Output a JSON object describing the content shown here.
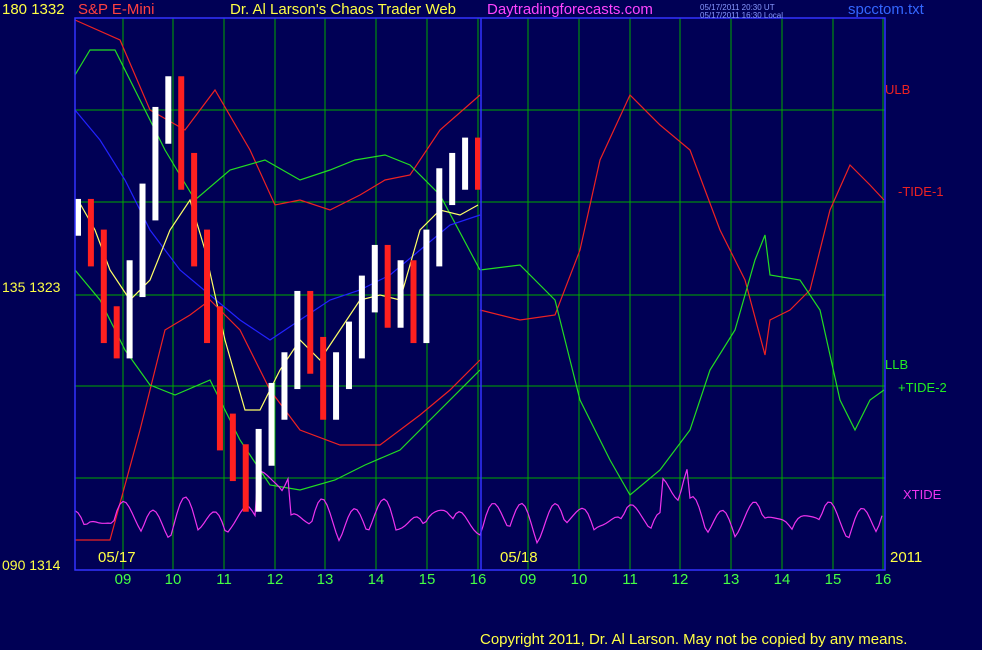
{
  "header": {
    "y_top_label": "180  1332",
    "instrument": "S&P E-Mini",
    "title": "Dr. Al Larson's Chaos Trader Web",
    "website": "Daytradingforecasts.com",
    "timestamp_ut": "05/17/2011 20:30 UT",
    "timestamp_local": "05/17/2011 16:30 Local",
    "filename": "spcctom.txt"
  },
  "colors": {
    "background": "#000055",
    "grid": "#00aa00",
    "price_up": "#ffffff",
    "price_down": "#ff2020",
    "ulb": "#ee2222",
    "llb": "#22dd22",
    "tide": "#2222ff",
    "xtide": "#ee33ee",
    "avg": "#ffff66",
    "copyright": "#ffff44"
  },
  "chart_data": {
    "type": "line",
    "title": "Dr. Al Larson's Chaos Trader Web",
    "instrument": "S&P E-Mini",
    "y_axis": {
      "ticks": [
        {
          "label": "180  1332",
          "price": 1332
        },
        {
          "label": "135  1323",
          "price": 1323
        },
        {
          "label": "090  1314",
          "price": 1314
        }
      ],
      "ylim": [
        1314,
        1332
      ]
    },
    "x_axis": {
      "hour_labels": [
        "09",
        "10",
        "11",
        "12",
        "13",
        "14",
        "15",
        "16",
        "09",
        "10",
        "11",
        "12",
        "13",
        "14",
        "15",
        "16"
      ],
      "date_labels": [
        "05/17",
        "05/18"
      ],
      "year_label": "2011"
    },
    "right_labels": [
      "ULB",
      "-TIDE-1",
      "LLB",
      "+TIDE-2",
      "XTIDE"
    ],
    "series": [
      {
        "name": "ULB",
        "kind": "red"
      },
      {
        "name": "-TIDE-1",
        "kind": "red"
      },
      {
        "name": "LLB",
        "kind": "green"
      },
      {
        "name": "+TIDE-2",
        "kind": "green"
      },
      {
        "name": "XTIDE",
        "kind": "magenta"
      }
    ],
    "price_bars_approx": [
      1325.5,
      1324.5,
      1322.0,
      1321.5,
      1323.5,
      1326.0,
      1328.5,
      1329.5,
      1327.0,
      1324.5,
      1322.0,
      1318.5,
      1317.5,
      1316.5,
      1318.0,
      1319.5,
      1320.5,
      1322.5,
      1321.0,
      1319.5,
      1320.5,
      1321.5,
      1323.0,
      1324.0,
      1322.5,
      1323.5,
      1322.0,
      1324.5,
      1326.5,
      1327.0,
      1327.5,
      1327.0
    ]
  },
  "footer": {
    "copyright": "Copyright 2011, Dr. Al Larson. May not be copied by any means."
  }
}
